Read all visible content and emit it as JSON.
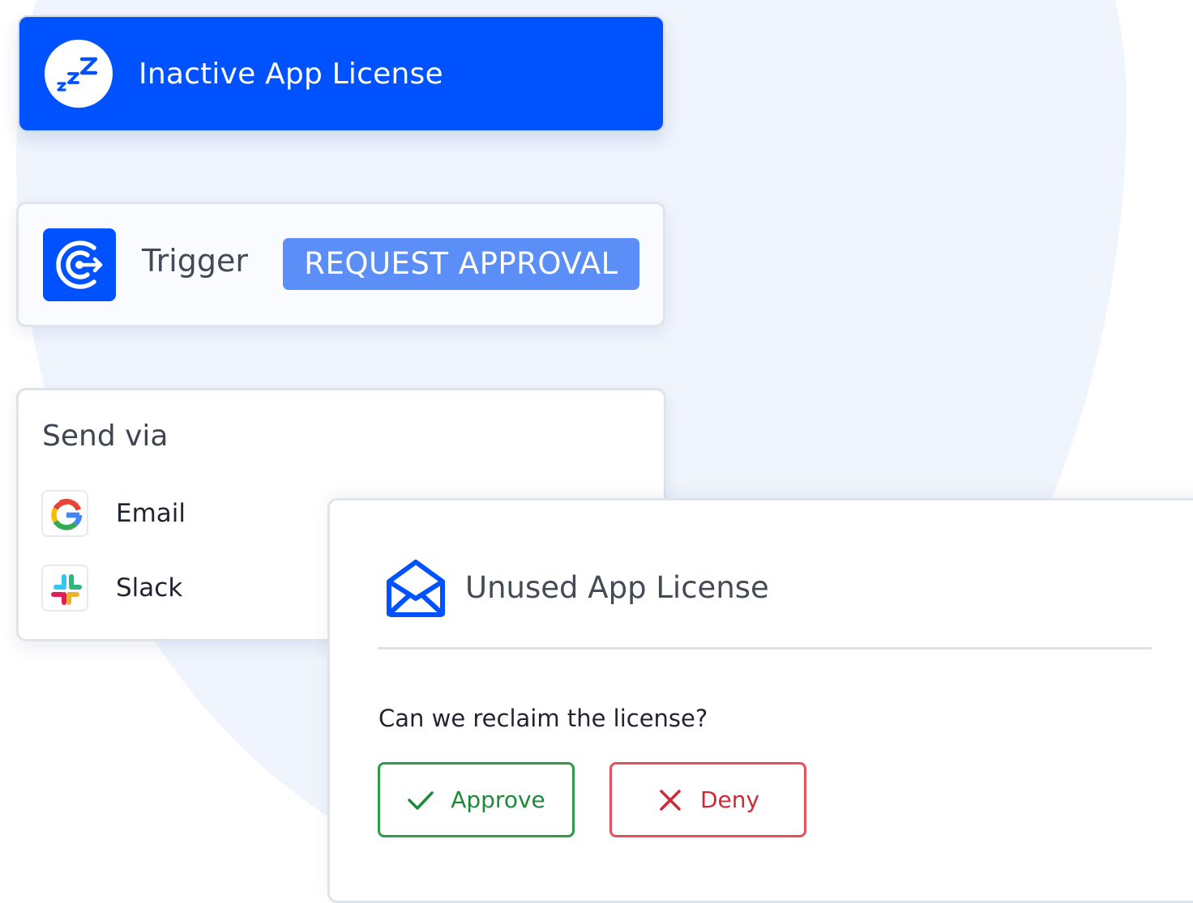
{
  "header": {
    "title": "Inactive App License",
    "badge_icon": "zzz-sleep-icon"
  },
  "trigger": {
    "label": "Trigger",
    "action": "REQUEST APPROVAL",
    "logo_icon": "trigger-logo-icon"
  },
  "send_via": {
    "title": "Send via",
    "channels": [
      {
        "label": "Email",
        "icon": "google-icon"
      },
      {
        "label": "Slack",
        "icon": "slack-icon"
      }
    ]
  },
  "message": {
    "title": "Unused App License",
    "question": "Can we reclaim the license?",
    "approve_label": "Approve",
    "deny_label": "Deny",
    "mail_icon": "envelope-open-icon"
  },
  "colors": {
    "brand_blue": "#0052ff",
    "chip_blue": "#5b8ff7",
    "approve_green": "#2f9a47",
    "deny_red": "#e6505a",
    "background_blob": "#eff4fd"
  }
}
